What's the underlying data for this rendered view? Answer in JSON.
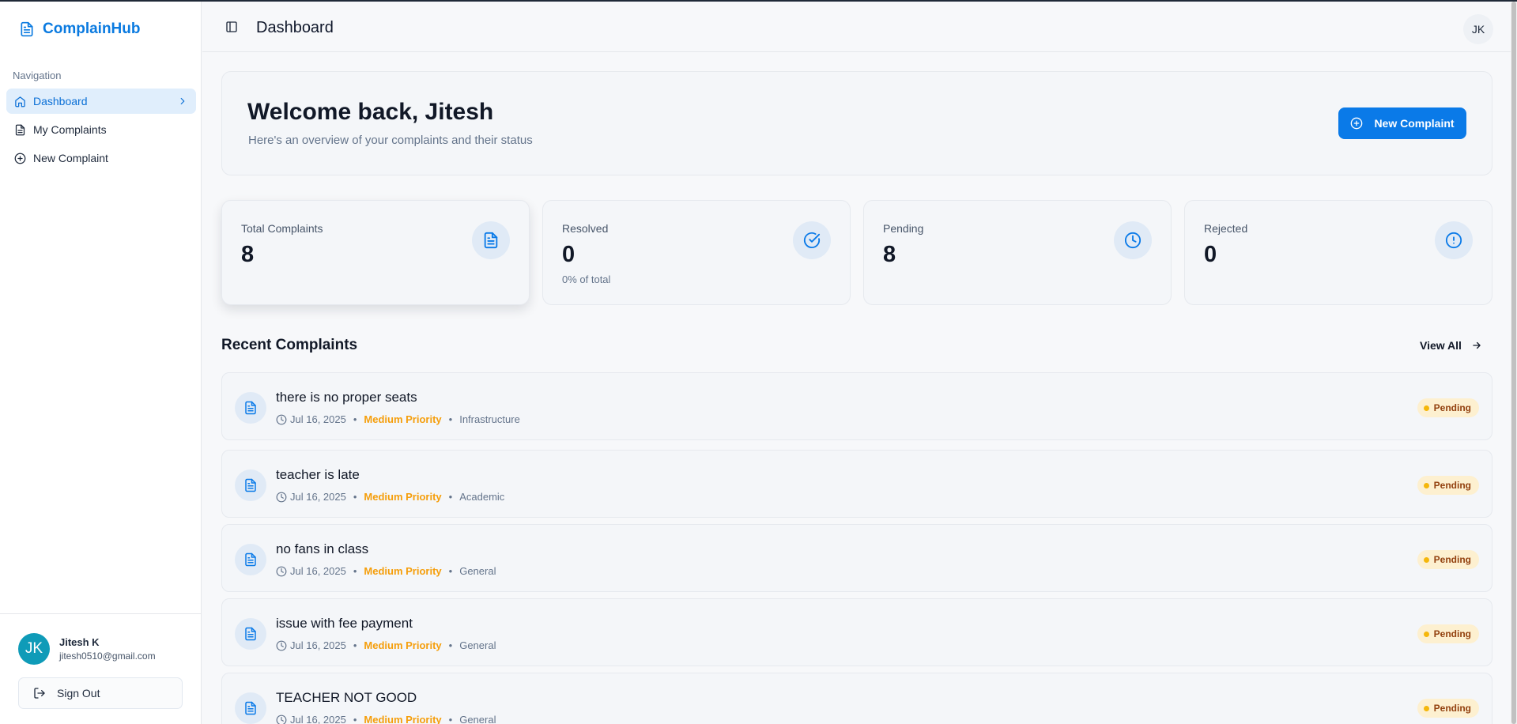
{
  "brand": {
    "name": "ComplainHub"
  },
  "sidebar": {
    "heading": "Navigation",
    "items": [
      {
        "label": "Dashboard",
        "icon": "home-icon",
        "active": true
      },
      {
        "label": "My Complaints",
        "icon": "file-icon"
      },
      {
        "label": "New Complaint",
        "icon": "plus-circle-icon"
      }
    ],
    "user": {
      "initials": "JK",
      "name": "Jitesh K",
      "email": "jitesh0510@gmail.com"
    },
    "signout_label": "Sign Out"
  },
  "header": {
    "title": "Dashboard",
    "avatar_initials": "JK"
  },
  "welcome": {
    "title": "Welcome back, Jitesh",
    "subtitle": "Here's an overview of your complaints and their status",
    "button_label": "New Complaint"
  },
  "stats": [
    {
      "label": "Total Complaints",
      "value": "8",
      "sub": "",
      "icon": "file-icon"
    },
    {
      "label": "Resolved",
      "value": "0",
      "sub": "0% of total",
      "icon": "check-circle-icon"
    },
    {
      "label": "Pending",
      "value": "8",
      "sub": "",
      "icon": "clock-icon"
    },
    {
      "label": "Rejected",
      "value": "0",
      "sub": "",
      "icon": "alert-circle-icon"
    }
  ],
  "recent": {
    "title": "Recent Complaints",
    "view_all": "View All",
    "separator": "•",
    "items": [
      {
        "title": "there is no proper seats",
        "date": "Jul 16, 2025",
        "priority": "Medium Priority",
        "category": "Infrastructure",
        "status": "Pending"
      },
      {
        "title": "teacher is late",
        "date": "Jul 16, 2025",
        "priority": "Medium Priority",
        "category": "Academic",
        "status": "Pending"
      },
      {
        "title": "no fans in class",
        "date": "Jul 16, 2025",
        "priority": "Medium Priority",
        "category": "General",
        "status": "Pending"
      },
      {
        "title": "issue with fee payment",
        "date": "Jul 16, 2025",
        "priority": "Medium Priority",
        "category": "General",
        "status": "Pending"
      },
      {
        "title": "TEACHER NOT GOOD",
        "date": "Jul 16, 2025",
        "priority": "Medium Priority",
        "category": "General",
        "status": "Pending"
      }
    ]
  },
  "colors": {
    "accent": "#0a7ae8",
    "priority": "#f59e0b",
    "pending_badge": "#fdf0d0"
  }
}
